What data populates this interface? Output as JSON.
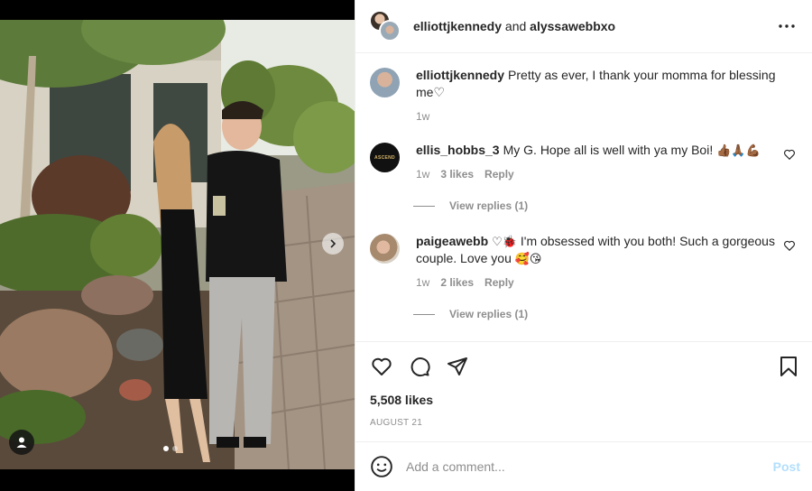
{
  "header": {
    "user1": "elliottjkennedy",
    "and": "and",
    "user2": "alyssawebbxo"
  },
  "comments": [
    {
      "username": "elliottjkennedy",
      "text": "Pretty as ever, I thank your momma for blessing me",
      "emoji_after": "♡",
      "time": "1w"
    },
    {
      "username": "ellis_hobbs_3",
      "avatar_text": "ASCEND",
      "text": "My G. Hope all is well with ya my Boi!",
      "emoji_after": "👍🏾🙏🏾💪🏾",
      "time": "1w",
      "likes": "3 likes",
      "reply": "Reply",
      "view_replies": "View replies (1)"
    },
    {
      "username": "paigeawebb",
      "emoji_before": "♡🐞",
      "text": "I'm obsessed with you both! Such a gorgeous couple. Love you",
      "emoji_after": "🥰😘",
      "time": "1w",
      "likes": "2 likes",
      "reply": "Reply",
      "view_replies": "View replies (1)"
    }
  ],
  "actions": {
    "likes": "5,508 likes",
    "date": "AUGUST 21"
  },
  "add_comment": {
    "placeholder": "Add a comment...",
    "post_label": "Post"
  },
  "icons": {
    "more": "more-options-icon",
    "like": "heart-icon",
    "comment": "comment-bubble-icon",
    "share": "paper-plane-icon",
    "save": "bookmark-icon",
    "emoji": "smiley-icon",
    "next": "chevron-right-icon",
    "tags": "user-tag-icon"
  },
  "colors": {
    "post_button": "#b2dffc",
    "muted_text": "#8e8e8e",
    "divider": "#efefef"
  },
  "carousel": {
    "current": 1,
    "total": 2
  }
}
